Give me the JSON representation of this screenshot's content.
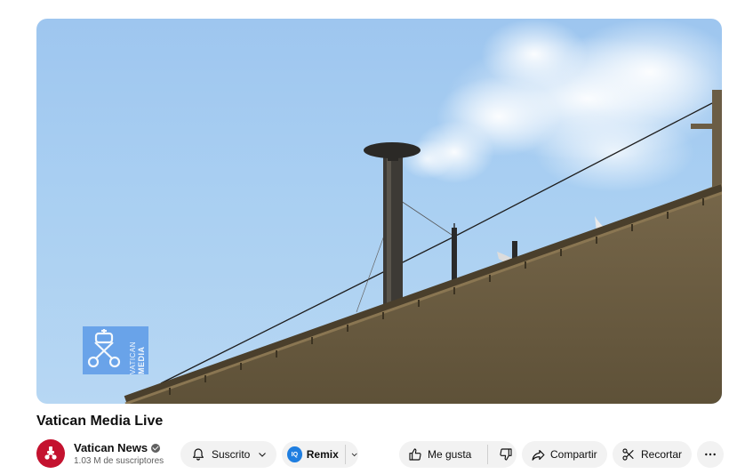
{
  "video": {
    "title": "Vatican Media Live",
    "watermark": {
      "line1": "VATICAN",
      "line2": "MEDIA"
    }
  },
  "channel": {
    "name": "Vatican News",
    "subscribers": "1.03 M de suscriptores",
    "verified": true,
    "avatar_color": "#c4122f"
  },
  "actions": {
    "subscribe_label": "Suscrito",
    "remix_label": "Remix",
    "remix_badge": "IQ",
    "like_label": "Me gusta",
    "share_label": "Compartir",
    "clip_label": "Recortar"
  },
  "colors": {
    "pill_bg": "#f2f2f2",
    "remix_badge": "#1f7ee0",
    "watermark_bg": "#5d9be8"
  }
}
